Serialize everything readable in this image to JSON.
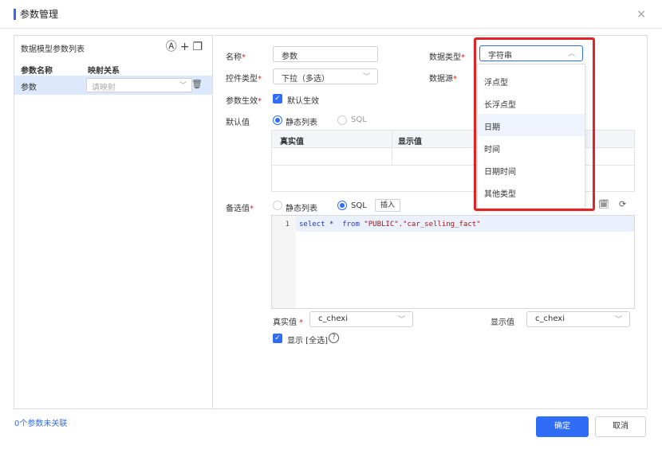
{
  "dialog": {
    "title": "参数管理",
    "close": "×"
  },
  "left": {
    "title": "数据模型参数列表",
    "icons": [
      "at-icon",
      "plus-icon",
      "copy-icon"
    ],
    "col_name": "参数名称",
    "col_map": "映射关系",
    "rows": [
      {
        "name": "参数",
        "map_placeholder": "请映射"
      }
    ],
    "footer": "0个参数未关联"
  },
  "form": {
    "name_label": "名称",
    "name_value": "参数",
    "control_label": "控件类型",
    "control_value": "下拉（多选）",
    "effect_label": "参数生效",
    "effect_check": "默认生效",
    "default_label": "默认值",
    "default_opt1": "静态列表",
    "default_opt2": "SQL",
    "table_col1": "真实值",
    "table_col2": "显示值",
    "datatype_label": "数据类型",
    "datatype_value": "字符串",
    "datasource_label": "数据源",
    "alt_label": "备选值",
    "alt_opt1": "静态列表",
    "alt_opt2": "SQL",
    "insert_btn": "插入",
    "code_line_no": "1",
    "code_kw1": "select",
    "code_star": " *  ",
    "code_kw2": "from",
    "code_table": " \"PUBLIC\".",
    "code_str": "\"car_selling_fact\"",
    "real_label": "真实值",
    "real_value": "c_chexi",
    "display_label": "显示值",
    "display_value": "c_chexi",
    "show_all": "显示 [全选]",
    "help": "?"
  },
  "dropdown": {
    "items": [
      "浮点型",
      "长浮点型",
      "日期",
      "时间",
      "日期时间",
      "其他类型"
    ],
    "hover_index": 2
  },
  "buttons": {
    "ok": "确定",
    "cancel": "取消"
  },
  "colors": {
    "accent": "#2f6df6",
    "highlight": "#e52222"
  }
}
